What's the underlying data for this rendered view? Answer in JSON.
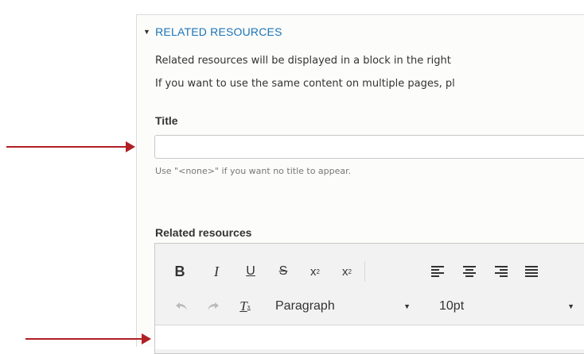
{
  "section": {
    "title": "RELATED RESOURCES",
    "description_line1": "Related resources will be displayed in a block in the right",
    "description_line2": "If you want to use the same content on multiple pages, pl"
  },
  "title_field": {
    "label": "Title",
    "value": "",
    "help": "Use \"<none>\" if you want no title to appear."
  },
  "related_field": {
    "label": "Related resources"
  },
  "toolbar": {
    "row1": [
      "bold-icon",
      "italic-icon",
      "underline-icon",
      "strikethrough-icon",
      "superscript-icon",
      "subscript-icon",
      "align-left-icon",
      "align-center-icon",
      "align-right-icon",
      "align-justify-icon"
    ],
    "row2": [
      "undo-icon",
      "redo-icon",
      "clear-formatting-icon"
    ],
    "format_select": "Paragraph",
    "font_size_select": "10pt"
  },
  "colors": {
    "accent": "#1a73b8",
    "arrow": "#b01f24"
  }
}
